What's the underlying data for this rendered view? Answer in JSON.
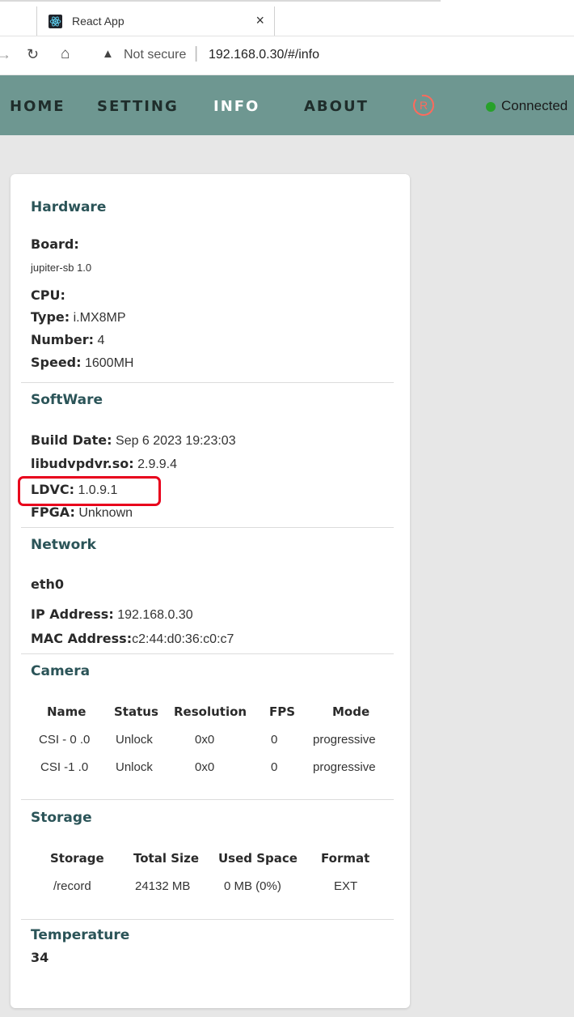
{
  "browser": {
    "tab_title": "React App",
    "tab_close": "×",
    "security_label": "Not secure",
    "url": "192.168.0.30/#/info"
  },
  "nav": {
    "items": [
      "HOME",
      "SETTING",
      "INFO",
      "ABOUT"
    ],
    "active": "INFO",
    "logo_letter": "R",
    "connection_status": "Connected",
    "connection_color": "#27a12a"
  },
  "hardware": {
    "title": "Hardware",
    "board_label": "Board:",
    "board_value": "jupiter-sb 1.0",
    "cpu_label": "CPU:",
    "type_label": "Type:",
    "type_value": "i.MX8MP",
    "number_label": "Number:",
    "number_value": "4",
    "speed_label": "Speed:",
    "speed_value": "1600MH"
  },
  "software": {
    "title": "SoftWare",
    "build_label": "Build Date:",
    "build_value": "Sep 6 2023 19:23:03",
    "lib_label": "libudvpdvr.so:",
    "lib_value": "2.9.9.4",
    "ldvc_label": "LDVC:",
    "ldvc_value": "1.0.9.1",
    "fpga_label": "FPGA:",
    "fpga_value": "Unknown"
  },
  "network": {
    "title": "Network",
    "interface": "eth0",
    "ip_label": "IP Address:",
    "ip_value": "192.168.0.30",
    "mac_label": "MAC Address:",
    "mac_value": "c2:44:d0:36:c0:c7"
  },
  "camera": {
    "title": "Camera",
    "headers": [
      "Name",
      "Status",
      "Resolution",
      "FPS",
      "Mode"
    ],
    "rows": [
      [
        "CSI - 0 .0",
        "Unlock",
        "0x0",
        "0",
        "progressive"
      ],
      [
        "CSI -1 .0",
        "Unlock",
        "0x0",
        "0",
        "progressive"
      ]
    ]
  },
  "storage": {
    "title": "Storage",
    "headers": [
      "Storage",
      "Total Size",
      "Used Space",
      "Format"
    ],
    "rows": [
      [
        "/record",
        "24132 MB",
        "0 MB (0%)",
        "EXT"
      ]
    ]
  },
  "temperature": {
    "title": "Temperature",
    "value": "34"
  },
  "colors": {
    "navbar": "#6e9791",
    "section_title": "#2b5458",
    "highlight_box": "#e8001c"
  }
}
